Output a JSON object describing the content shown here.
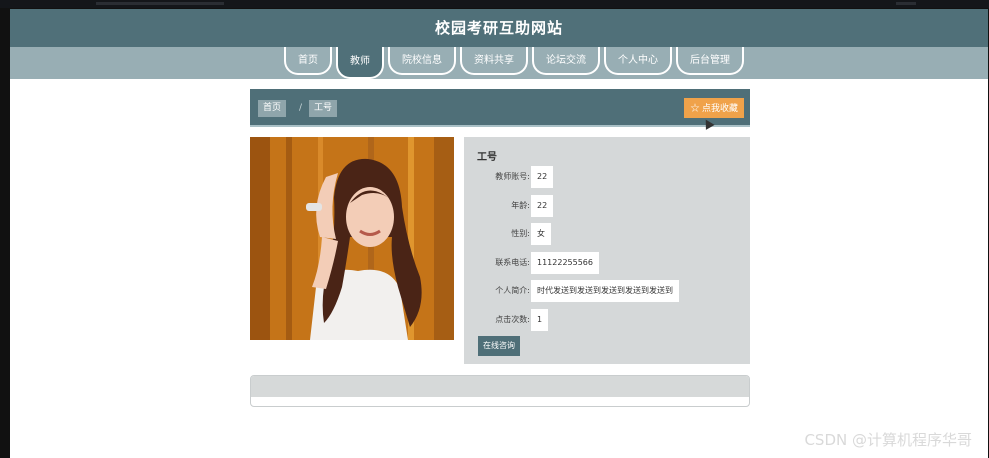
{
  "site": {
    "title": "校园考研互助网站"
  },
  "nav": {
    "items": [
      {
        "label": "首页"
      },
      {
        "label": "教师"
      },
      {
        "label": "院校信息"
      },
      {
        "label": "资料共享"
      },
      {
        "label": "论坛交流"
      },
      {
        "label": "个人中心"
      },
      {
        "label": "后台管理"
      }
    ],
    "active_index": 1
  },
  "breadcrumb": {
    "home": "首页",
    "current": "工号",
    "separator": "/",
    "favorite_label": "☆ 点我收藏"
  },
  "detail": {
    "title": "工号",
    "fields": [
      {
        "label": "教师账号:",
        "value": "22"
      },
      {
        "label": "年龄:",
        "value": "22"
      },
      {
        "label": "性别:",
        "value": "女"
      },
      {
        "label": "联系电话:",
        "value": "11122255566"
      },
      {
        "label": "个人简介:",
        "value": "时代发送到发送到发送到发送到发送到"
      },
      {
        "label": "点击次数:",
        "value": "1"
      }
    ],
    "consult_label": "在线咨询"
  },
  "colors": {
    "header": "#507079",
    "nav": "#98aeb4",
    "favorite": "#f0a24a",
    "panel": "#d5d8d9"
  },
  "watermark": "CSDN @计算机程序华哥"
}
